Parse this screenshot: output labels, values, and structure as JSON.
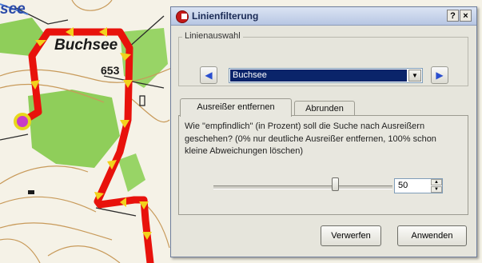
{
  "map": {
    "place_name": "Buchsee",
    "place_name_partial": "see",
    "elevation": "653",
    "route_color": "#e8120c",
    "arrow_color": "#f2d21c",
    "forest_color": "#8fce5a",
    "marker_color": "#c83cc8"
  },
  "dialog": {
    "title": "Linienfilterung",
    "help_button": "?",
    "close_button": "×",
    "group_label": "Linienauswahl",
    "prev_icon": "triangle-left",
    "next_icon": "triangle-right",
    "selected_line": "Buchsee",
    "tabs": [
      {
        "label": "Ausreißer entfernen",
        "active": true
      },
      {
        "label": "Abrunden",
        "active": false
      }
    ],
    "description": "Wie \"empfindlich\" (in Prozent) soll die Suche nach Ausreißern geschehen? (0% nur deutliche Ausreißer entfernen, 100% schon kleine Abweichungen löschen)",
    "sensitivity_percent": 50,
    "spin_value": "50",
    "buttons": {
      "discard": "Verwerfen",
      "apply": "Anwenden"
    }
  }
}
